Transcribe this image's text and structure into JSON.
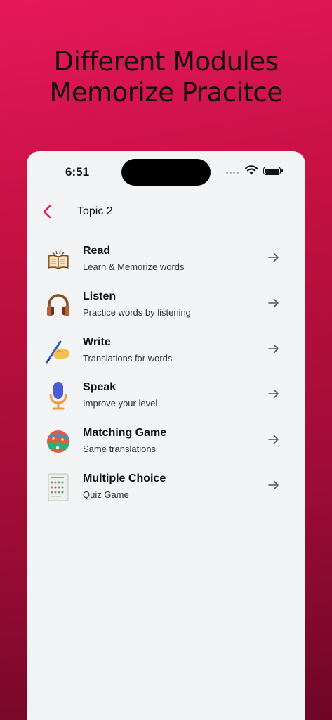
{
  "headline": {
    "line1": "Different Modules",
    "line2": "Memorize Pracitce"
  },
  "status_bar": {
    "time": "6:51"
  },
  "nav": {
    "title": "Topic 2"
  },
  "modules": [
    {
      "title": "Read",
      "subtitle": "Learn & Memorize words",
      "icon": "book-icon"
    },
    {
      "title": "Listen",
      "subtitle": "Practice words by listening",
      "icon": "headphones-icon"
    },
    {
      "title": "Write",
      "subtitle": "Translations for words",
      "icon": "writing-hand-icon"
    },
    {
      "title": "Speak",
      "subtitle": "Improve your level",
      "icon": "microphone-icon"
    },
    {
      "title": "Matching Game",
      "subtitle": "Same translations",
      "icon": "puzzle-ball-icon"
    },
    {
      "title": "Multiple Choice",
      "subtitle": "Quiz Game",
      "icon": "quiz-sheet-icon"
    }
  ],
  "colors": {
    "accent": "#e11d48",
    "background_top": "#e6185a",
    "background_bottom": "#6e0627",
    "card": "#f3f4f6"
  }
}
